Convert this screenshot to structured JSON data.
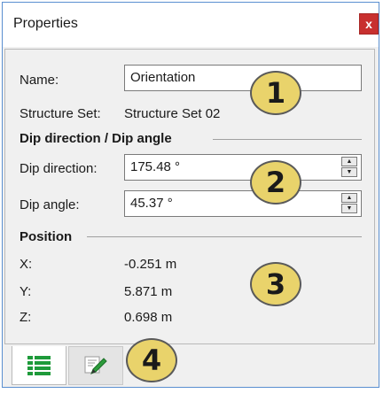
{
  "window": {
    "title": "Properties",
    "close_label": "x"
  },
  "name_row": {
    "label": "Name:",
    "value": "Orientation"
  },
  "structure_set": {
    "label": "Structure Set:",
    "value": "Structure Set 02"
  },
  "dip_section": {
    "title": "Dip direction / Dip angle",
    "dip_direction": {
      "label": "Dip direction:",
      "value": "175.48 °"
    },
    "dip_angle": {
      "label": "Dip angle:",
      "value": "45.37 °"
    }
  },
  "position_section": {
    "title": "Position",
    "x": {
      "label": "X:",
      "value": "-0.251 m"
    },
    "y": {
      "label": "Y:",
      "value": "5.871 m"
    },
    "z": {
      "label": "Z:",
      "value": "0.698 m"
    }
  },
  "callouts": [
    "1",
    "2",
    "3",
    "4"
  ],
  "tabs": [
    {
      "icon": "list-icon"
    },
    {
      "icon": "edit-notes-icon"
    }
  ],
  "colors": {
    "close": "#c8302f",
    "badge": "#e9d36b",
    "list_icon": "#1e9a3a",
    "window_border": "#5a8fd0"
  }
}
